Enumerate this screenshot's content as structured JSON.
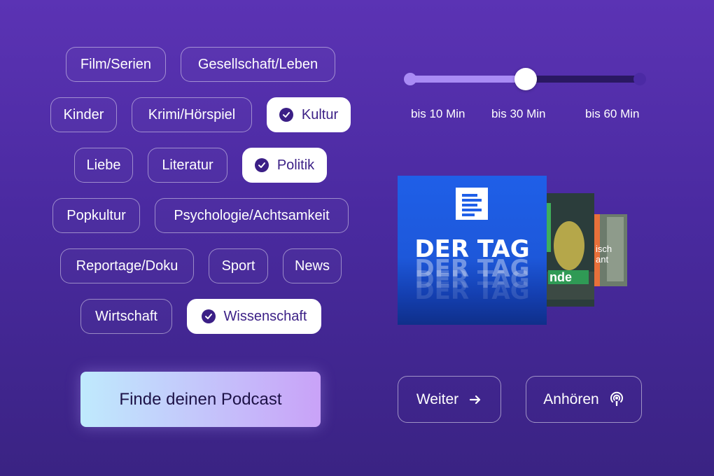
{
  "categories": [
    {
      "label": "Film/Serien",
      "selected": false
    },
    {
      "label": "Gesellschaft/Leben",
      "selected": false
    },
    {
      "label": "Kinder",
      "selected": false
    },
    {
      "label": "Krimi/Hörspiel",
      "selected": false
    },
    {
      "label": "Kultur",
      "selected": true
    },
    {
      "label": "Liebe",
      "selected": false
    },
    {
      "label": "Literatur",
      "selected": false
    },
    {
      "label": "Politik",
      "selected": true
    },
    {
      "label": "Popkultur",
      "selected": false
    },
    {
      "label": "Psychologie/Achtsamkeit",
      "selected": false
    },
    {
      "label": "Reportage/Doku",
      "selected": false
    },
    {
      "label": "Sport",
      "selected": false
    },
    {
      "label": "News",
      "selected": false
    },
    {
      "label": "Wirtschaft",
      "selected": false
    },
    {
      "label": "Wissenschaft",
      "selected": true
    }
  ],
  "duration": {
    "labels": [
      "bis 10 Min",
      "bis 30 Min",
      "bis 60 Min"
    ],
    "selected_index": 1
  },
  "covers": {
    "main_title": "DER TAG",
    "second_text": "nde",
    "third_text": "isch ant"
  },
  "buttons": {
    "find_podcast": "Finde deinen Podcast",
    "next": "Weiter",
    "listen": "Anhören"
  },
  "colors": {
    "background": "#4a2aa0",
    "selected_chip_text": "#3b1f86",
    "slider_fill": "#a98bf5",
    "slider_track": "#2a1862",
    "cover_blue": "#1f5fe8"
  },
  "icons": {
    "check": "check-circle-icon",
    "next": "arrow-right-icon",
    "listen": "podcast-icon",
    "cover_logo": "deutschlandfunk-logo"
  }
}
